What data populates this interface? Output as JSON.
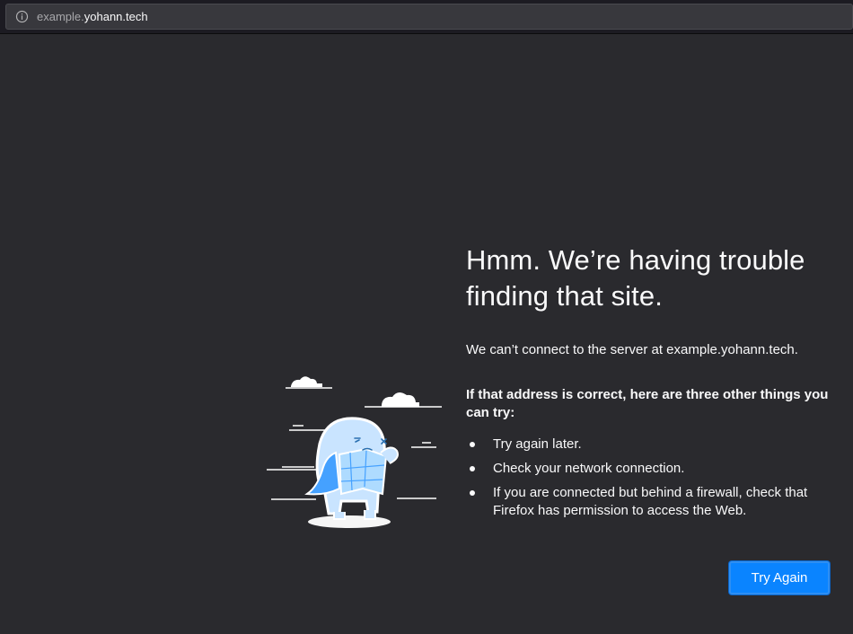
{
  "urlbar": {
    "url_prefix": "example.",
    "url_domain": "yohann.tech",
    "info_icon": "info-icon"
  },
  "error": {
    "title": "Hmm. We’re having trouble finding that site.",
    "short_desc": "We can’t connect to the server at example.yohann.tech.",
    "what_to_do": "If that address is correct, here are three other things you can try:",
    "tips": [
      "Try again later.",
      "Check your network connection.",
      "If you are connected but behind a firewall, check that Firefox has permission to access the Web."
    ],
    "try_again_label": "Try Again",
    "illustration": "confused-dinosaur-with-map-illustration"
  },
  "colors": {
    "page_background": "#2a2a2e",
    "urlbar_background": "#38383d",
    "primary_button": "#0a84ff",
    "text": "#f9f9fa",
    "illustration_accent": "#45a1ff"
  }
}
